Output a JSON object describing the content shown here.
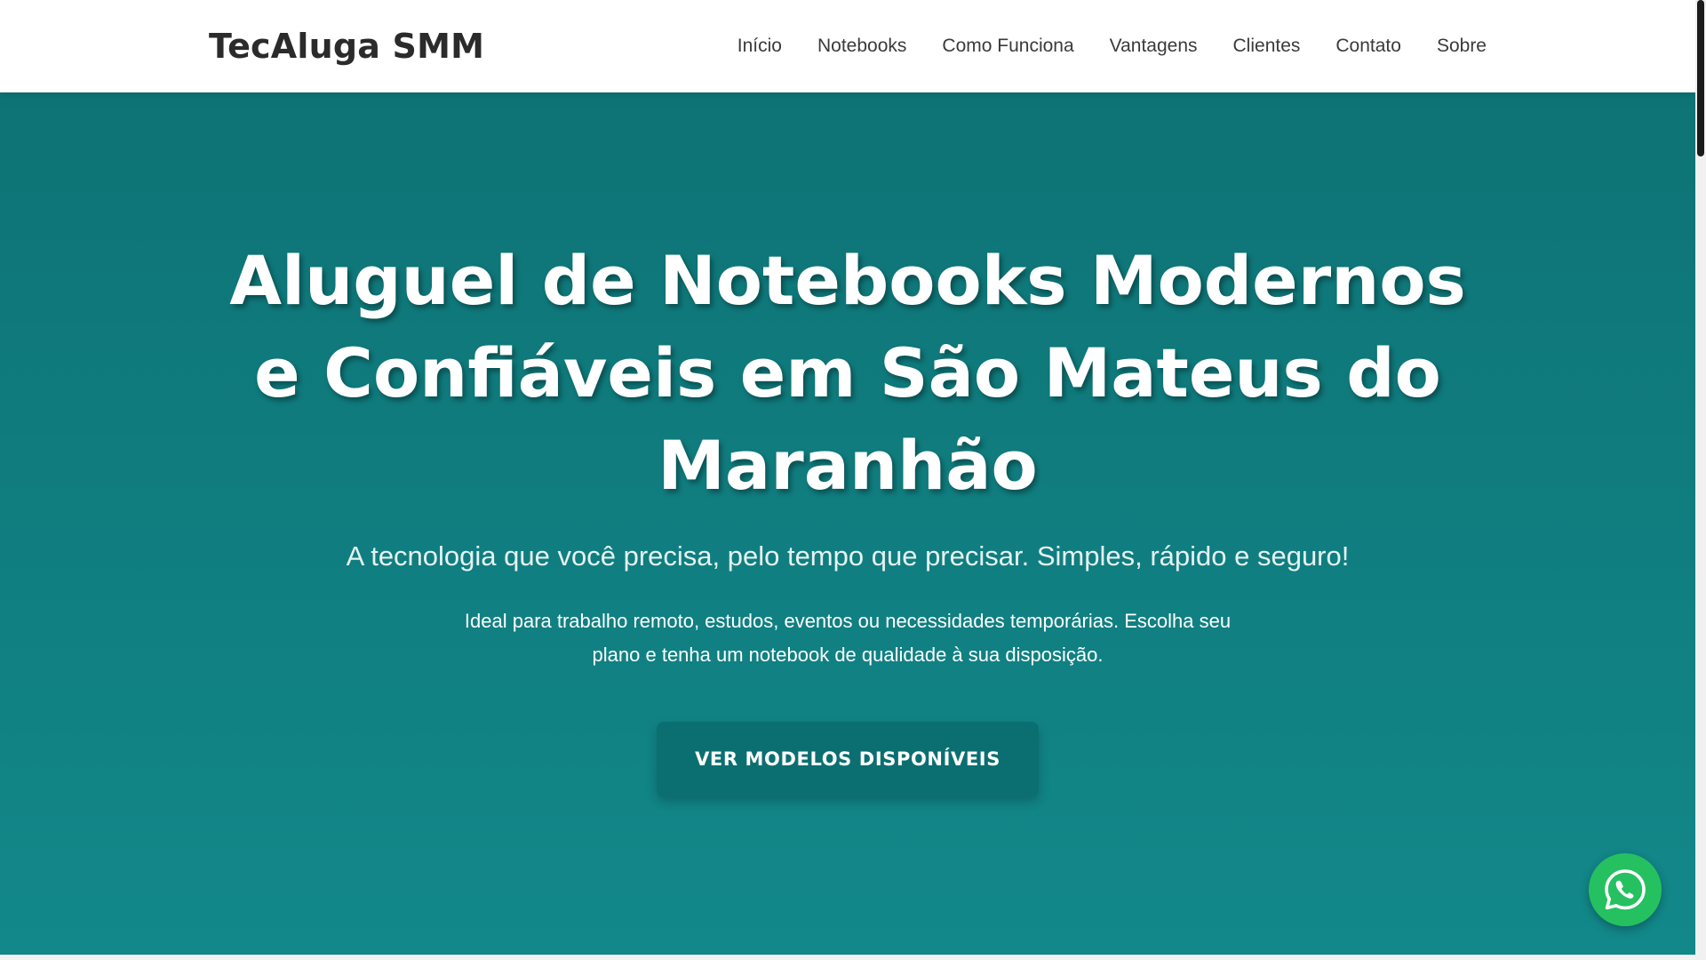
{
  "header": {
    "brand": "TecAluga SMM",
    "nav": [
      {
        "label": "Início"
      },
      {
        "label": "Notebooks"
      },
      {
        "label": "Como Funciona"
      },
      {
        "label": "Vantagens"
      },
      {
        "label": "Clientes"
      },
      {
        "label": "Contato"
      },
      {
        "label": "Sobre"
      }
    ]
  },
  "hero": {
    "title": "Aluguel de Notebooks Modernos e Confiáveis em São Mateus do Maranhão",
    "subtitle": "A tecnologia que você precisa, pelo tempo que precisar. Simples, rápido e seguro!",
    "text": "Ideal para trabalho remoto, estudos, eventos ou necessidades temporárias. Escolha seu plano e tenha um notebook de qualidade à sua disposição.",
    "cta_label": "VER MODELOS DISPONÍVEIS"
  },
  "floating": {
    "icon": "whatsapp-icon"
  },
  "colors": {
    "hero_top": "#0e7375",
    "hero_bottom": "#12888a",
    "cta_bg": "#0b6f71",
    "whatsapp_green": "#25c161",
    "brand_text": "#2b2b2b"
  }
}
